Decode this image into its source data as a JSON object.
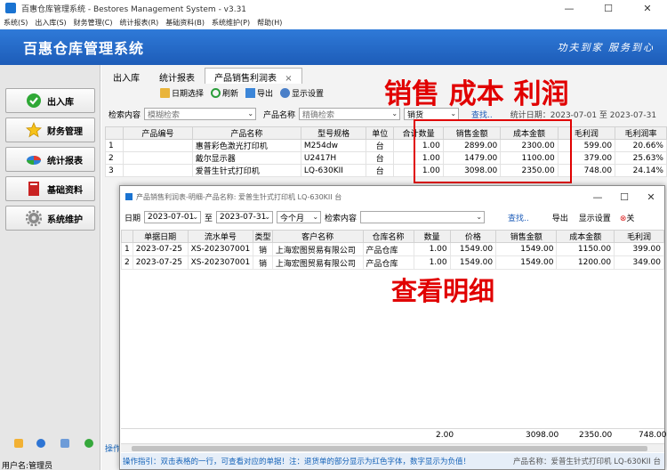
{
  "window": {
    "title": "百惠仓库管理系统 - Bestores Management System - v3.31",
    "minimize": "—",
    "maximize": "☐",
    "close": "✕"
  },
  "menu": [
    "系统(S)",
    "出入库(S)",
    "财务管理(C)",
    "统计报表(R)",
    "基础资料(B)",
    "系统维护(P)",
    "帮助(H)"
  ],
  "banner": {
    "title": "百惠仓库管理系统",
    "slogan": "功夫到家 服务到心"
  },
  "nav": [
    {
      "label": "出入库",
      "icon": "check-icon"
    },
    {
      "label": "财务管理",
      "icon": "star-icon"
    },
    {
      "label": "统计报表",
      "icon": "pie-chart-icon"
    },
    {
      "label": "基础资料",
      "icon": "book-icon"
    },
    {
      "label": "系统维护",
      "icon": "gear-icon"
    }
  ],
  "status": {
    "user": "用户名:管理员",
    "op_prefix": "操作"
  },
  "tabs": [
    "出入库",
    "统计报表",
    "产品销售利润表"
  ],
  "tab_close": "×",
  "toolbar": {
    "date_select": "日期选择",
    "refresh": "刷新",
    "export": "导出",
    "display_settings": "显示设置"
  },
  "search": {
    "content_label": "检索内容",
    "content_placeholder": "模糊检索",
    "product_label": "产品名称",
    "product_placeholder": "精确检索",
    "type_value": "销货",
    "find": "查找..",
    "stat_date": "统计日期：2023-07-01 至 2023-07-31"
  },
  "main_table": {
    "headers": [
      "",
      "产品编号",
      "产品名称",
      "型号规格",
      "单位",
      "合计数量",
      "销售金额",
      "成本金额",
      "毛利润",
      "毛利润率"
    ],
    "rows": [
      [
        "1",
        "",
        "惠普彩色激光打印机",
        "M254dw",
        "台",
        "1.00",
        "2899.00",
        "2300.00",
        "599.00",
        "20.66%"
      ],
      [
        "2",
        "",
        "戴尔显示器",
        "U2417H",
        "台",
        "1.00",
        "1479.00",
        "1100.00",
        "379.00",
        "25.63%"
      ],
      [
        "3",
        "",
        "爱普生针式打印机",
        "LQ-630KII",
        "台",
        "1.00",
        "3098.00",
        "2350.00",
        "748.00",
        "24.14%"
      ]
    ]
  },
  "annotations": {
    "top": "销售 成本 利润",
    "bottom": "查看明细"
  },
  "dialog": {
    "title": "产品销售利润表-明细-产品名称: 爱普生针式打印机 LQ-630KII 台",
    "date_label": "日期",
    "date_from": "2023-07-01",
    "to": "至",
    "date_to": "2023-07-31",
    "period": "今个月",
    "search_label": "检索内容",
    "find": "查找..",
    "export": "导出",
    "display_settings": "显示设置",
    "close_partial": "关",
    "headers": [
      "",
      "单据日期",
      "流水单号",
      "类型",
      "客户名称",
      "仓库名称",
      "数量",
      "价格",
      "销售金额",
      "成本金额",
      "毛利润"
    ],
    "rows": [
      [
        "1",
        "2023-07-25",
        "XS-202307001",
        "销",
        "上海宏图贸易有限公司",
        "产品仓库",
        "1.00",
        "1549.00",
        "1549.00",
        "1150.00",
        "399.00"
      ],
      [
        "2",
        "2023-07-25",
        "XS-202307001",
        "销",
        "上海宏图贸易有限公司",
        "产品仓库",
        "1.00",
        "1549.00",
        "1549.00",
        "1200.00",
        "349.00"
      ]
    ],
    "totals": {
      "qty": "2.00",
      "sales": "3098.00",
      "cost": "2350.00",
      "profit": "748.00"
    },
    "hint": "操作指引：双击表格的一行，可查看对应的单据！注：退货单的部分显示为红色字体，数字显示为负值！",
    "footer_product": "产品名称：爱普生针式打印机 LQ-630KII 台"
  },
  "colors": {
    "banner": "#1d5cb8",
    "accent_red": "#e10000",
    "hint_text": "#1462b8"
  }
}
